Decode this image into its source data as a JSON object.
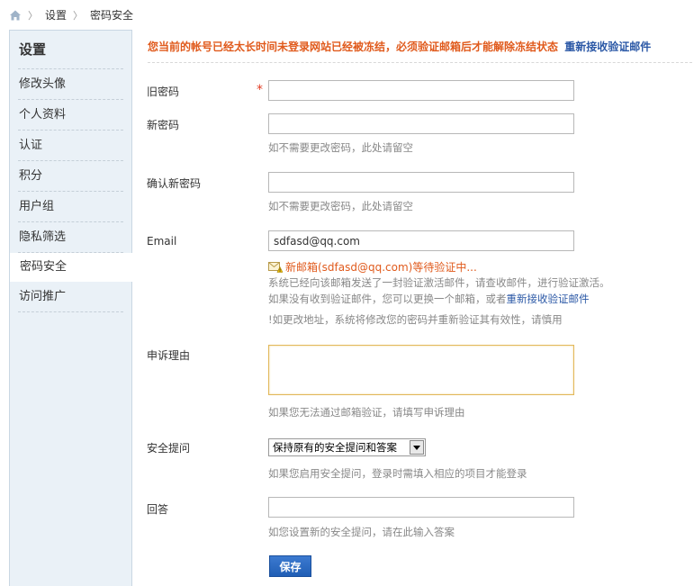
{
  "breadcrumb": {
    "items": [
      "设置",
      "密码安全"
    ]
  },
  "sidebar": {
    "title": "设置",
    "items": [
      {
        "label": "修改头像"
      },
      {
        "label": "个人资料"
      },
      {
        "label": "认证"
      },
      {
        "label": "积分"
      },
      {
        "label": "用户组"
      },
      {
        "label": "隐私筛选"
      },
      {
        "label": "密码安全",
        "active": true
      },
      {
        "label": "访问推广"
      }
    ]
  },
  "alert": {
    "text": "您当前的帐号已经太长时间未登录网站已经被冻结，必须验证邮箱后才能解除冻结状态",
    "link": "重新接收验证邮件"
  },
  "form": {
    "old_password": {
      "label": "旧密码",
      "required_mark": "*",
      "value": ""
    },
    "new_password": {
      "label": "新密码",
      "value": "",
      "hint": "如不需要更改密码，此处请留空"
    },
    "confirm_password": {
      "label": "确认新密码",
      "value": "",
      "hint": "如不需要更改密码，此处请留空"
    },
    "email": {
      "label": "Email",
      "value": "sdfasd@qq.com",
      "pending": "新邮箱(sdfasd@qq.com)等待验证中...",
      "hint1": "系统已经向该邮箱发送了一封验证激活邮件，请查收邮件，进行验证激活。",
      "hint2_prefix": "如果没有收到验证邮件，您可以更换一个邮箱，或者",
      "hint2_link": "重新接收验证邮件",
      "hint3": "!如更改地址，系统将修改您的密码并重新验证其有效性，请慎用"
    },
    "appeal": {
      "label": "申诉理由",
      "value": "",
      "hint": "如果您无法通过邮箱验证，请填写申诉理由"
    },
    "security_question": {
      "label": "安全提问",
      "selected": "保持原有的安全提问和答案",
      "hint": "如果您启用安全提问，登录时需填入相应的项目才能登录"
    },
    "answer": {
      "label": "回答",
      "value": "",
      "hint": "如您设置新的安全提问，请在此输入答案"
    },
    "save_label": "保存"
  },
  "colors": {
    "alert": "#e05a1c",
    "link": "#2b58a6",
    "sidebar_bg": "#eaf1f7",
    "button": "#205eb5"
  }
}
